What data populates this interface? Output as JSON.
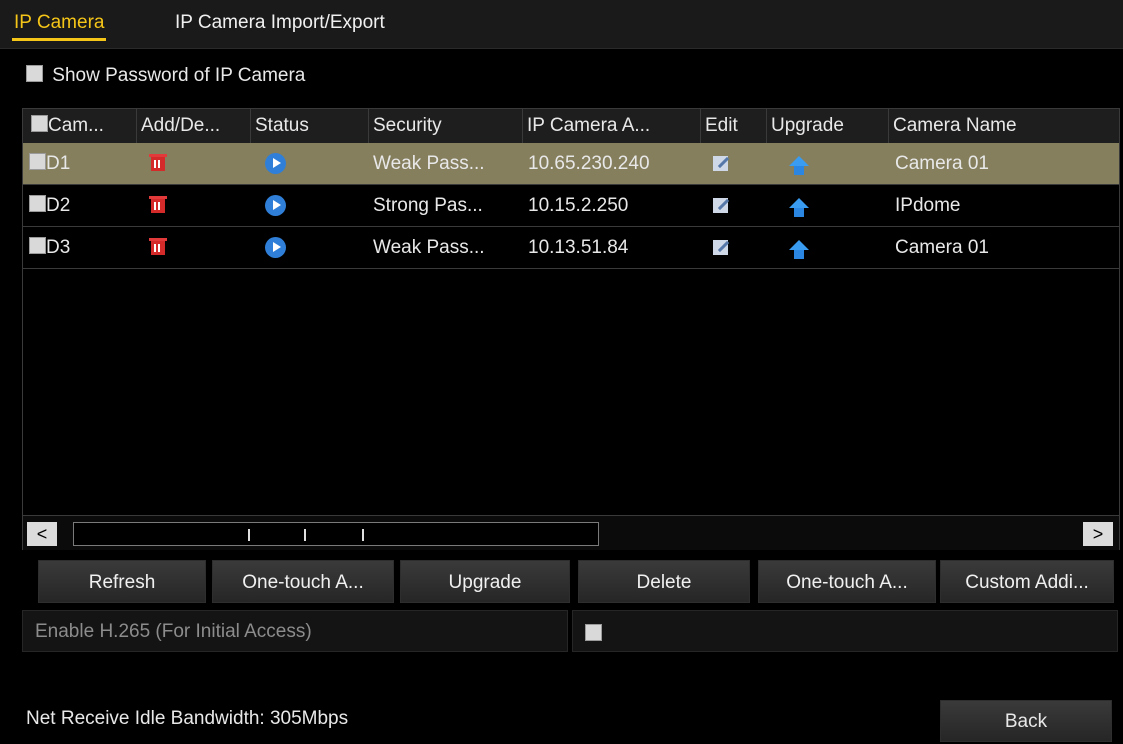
{
  "tabs": [
    "IP Camera",
    "IP Camera Import/Export"
  ],
  "show_password_label": "Show Password of IP Camera",
  "table": {
    "columns": [
      "Cam...",
      "Add/De...",
      "Status",
      "Security",
      "IP Camera A...",
      "Edit",
      "Upgrade",
      "Camera Name"
    ],
    "rows": [
      {
        "cam": "D1",
        "security": "Weak Pass...",
        "ip": "10.65.230.240",
        "name": "Camera 01",
        "selected": true
      },
      {
        "cam": "D2",
        "security": "Strong Pas...",
        "ip": "10.15.2.250",
        "name": "IPdome",
        "selected": false
      },
      {
        "cam": "D3",
        "security": "Weak Pass...",
        "ip": "10.13.51.84",
        "name": "Camera 01",
        "selected": false
      }
    ]
  },
  "scroll": {
    "left": "<",
    "right": ">"
  },
  "buttons": {
    "refresh": "Refresh",
    "one_touch_activate": "One-touch A...",
    "upgrade": "Upgrade",
    "delete": "Delete",
    "one_touch_adding": "One-touch A...",
    "custom_adding": "Custom Addi..."
  },
  "h265_label": "Enable H.265 (For Initial Access)",
  "status_text": "Net Receive Idle Bandwidth: 305Mbps",
  "back_label": "Back",
  "icons": {
    "delete": "trash-icon",
    "status": "play-icon",
    "edit": "edit-icon",
    "upgrade": "upgrade-arrow-icon"
  },
  "colors": {
    "accent": "#f5c518",
    "selected_row": "#857f5e",
    "trash": "#d42a2a",
    "status_play": "#2f7fd8",
    "upgrade_arrow": "#3a9cf0"
  }
}
